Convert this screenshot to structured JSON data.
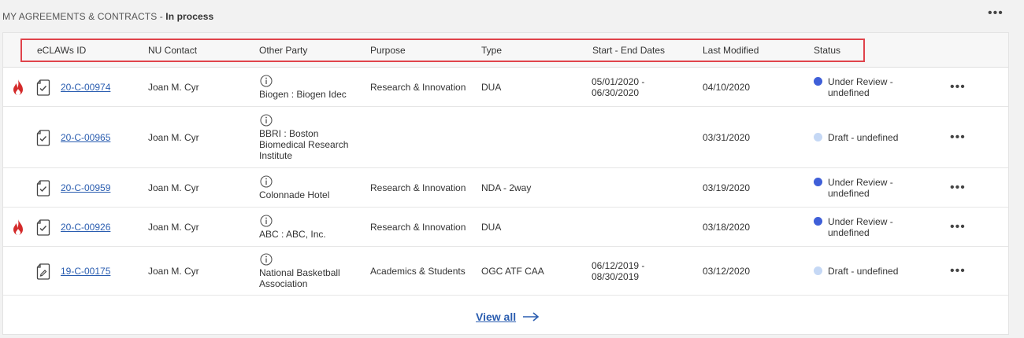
{
  "section": {
    "title": "MY AGREEMENTS & CONTRACTS",
    "separator": " - ",
    "subtitle": "In process",
    "more_icon": "more-horizontal-icon"
  },
  "table": {
    "columns": [
      "eCLAWs ID",
      "NU Contact",
      "Other Party",
      "Purpose",
      "Type",
      "Start - End Dates",
      "Last Modified",
      "Status"
    ],
    "rows": [
      {
        "hot": true,
        "doc_icon": "document-check-icon",
        "id": "20-C-00974",
        "contact": "Joan M. Cyr",
        "party": "Biogen : Biogen Idec",
        "purpose": "Research & Innovation",
        "type": "DUA",
        "dates": "05/01/2020 - 06/30/2020",
        "modified": "04/10/2020",
        "status": "Under Review - undefined",
        "status_color": "#3f5fd8"
      },
      {
        "hot": false,
        "doc_icon": "document-check-icon",
        "id": "20-C-00965",
        "contact": "Joan M. Cyr",
        "party": "BBRI : Boston Biomedical Research Institute",
        "purpose": "",
        "type": "",
        "dates": "",
        "modified": "03/31/2020",
        "status": "Draft - undefined",
        "status_color": "#c5d8f5"
      },
      {
        "hot": false,
        "doc_icon": "document-check-icon",
        "id": "20-C-00959",
        "contact": "Joan M. Cyr",
        "party": "Colonnade Hotel",
        "purpose": "Research & Innovation",
        "type": "NDA - 2way",
        "dates": "",
        "modified": "03/19/2020",
        "status": "Under Review - undefined",
        "status_color": "#3f5fd8"
      },
      {
        "hot": true,
        "doc_icon": "document-check-icon",
        "id": "20-C-00926",
        "contact": "Joan M. Cyr",
        "party": "ABC : ABC, Inc.",
        "purpose": "Research & Innovation",
        "type": "DUA",
        "dates": "",
        "modified": "03/18/2020",
        "status": "Under Review - undefined",
        "status_color": "#3f5fd8"
      },
      {
        "hot": false,
        "doc_icon": "document-edit-icon",
        "id": "19-C-00175",
        "contact": "Joan M. Cyr",
        "party": "National Basketball Association",
        "purpose": "Academics & Students",
        "type": "OGC ATF CAA",
        "dates": "06/12/2019 - 08/30/2019",
        "modified": "03/12/2020",
        "status": "Draft - undefined",
        "status_color": "#c5d8f5"
      }
    ]
  },
  "footer": {
    "view_all": "View all",
    "arrow_icon": "arrow-right-icon"
  },
  "colors": {
    "link": "#2a5db0",
    "highlight_border": "#e0434b",
    "flame": "#d42a2a",
    "status_under_review": "#3f5fd8",
    "status_draft": "#c5d8f5"
  }
}
